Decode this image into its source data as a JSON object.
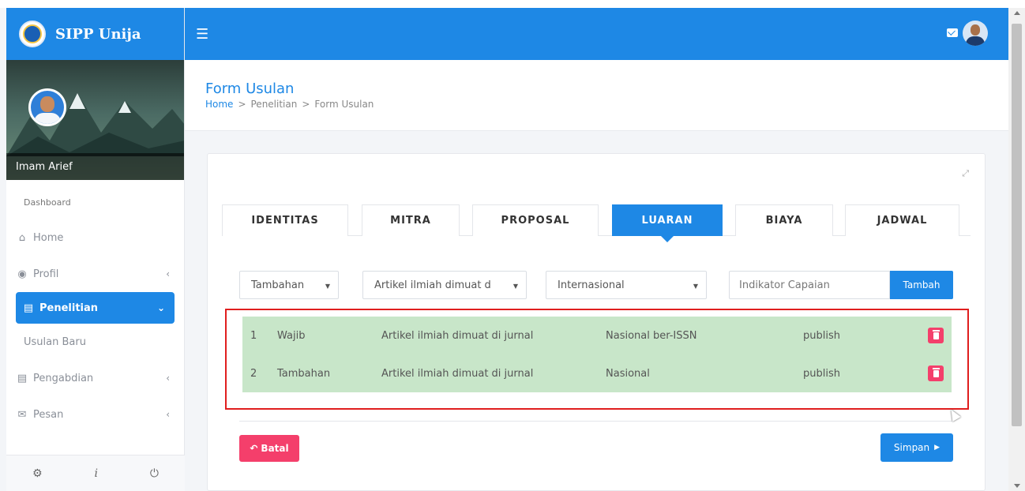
{
  "app": {
    "title": "SIPP Unija",
    "colors": {
      "primary": "#1e88e5",
      "danger": "#f43f6b",
      "row_bg": "#c8e6c9",
      "highlight_border": "#e01e1e"
    }
  },
  "sidebar": {
    "user_name": "Imam Arief",
    "section_label": "Dashboard",
    "items": [
      {
        "label": "Home",
        "icon": "home-icon"
      },
      {
        "label": "Profil",
        "icon": "user-circle-icon"
      },
      {
        "label": "Penelitian",
        "icon": "document-icon"
      },
      {
        "label": "Pengabdian",
        "icon": "document-icon"
      },
      {
        "label": "Pesan",
        "icon": "mail-icon"
      }
    ],
    "sub_item": "Usulan Baru",
    "footer_icons": [
      "gear-icon",
      "info-icon",
      "power-icon"
    ]
  },
  "topbar": {
    "menu_icon": "hamburger-icon",
    "mail_icon": "mail-icon",
    "avatar": "user-avatar"
  },
  "header": {
    "title": "Form Usulan",
    "breadcrumb": [
      "Home",
      "Penelitian",
      "Form Usulan"
    ]
  },
  "tabs": [
    "IDENTITAS",
    "MITRA",
    "PROPOSAL",
    "LUARAN",
    "BIAYA",
    "JADWAL"
  ],
  "active_tab": "LUARAN",
  "form": {
    "jenis": "Tambahan",
    "luaran": "Artikel ilmiah dimuat d",
    "tingkat": "Internasional",
    "indikator_placeholder": "Indikator Capaian",
    "add_label": "Tambah"
  },
  "rows": [
    {
      "no": "1",
      "jenis": "Wajib",
      "luaran": "Artikel ilmiah dimuat di jurnal",
      "tingkat": "Nasional ber-ISSN",
      "status": "publish"
    },
    {
      "no": "2",
      "jenis": "Tambahan",
      "luaran": "Artikel ilmiah dimuat di jurnal",
      "tingkat": "Nasional",
      "status": "publish"
    }
  ],
  "actions": {
    "cancel": "Batal",
    "save": "Simpan"
  }
}
